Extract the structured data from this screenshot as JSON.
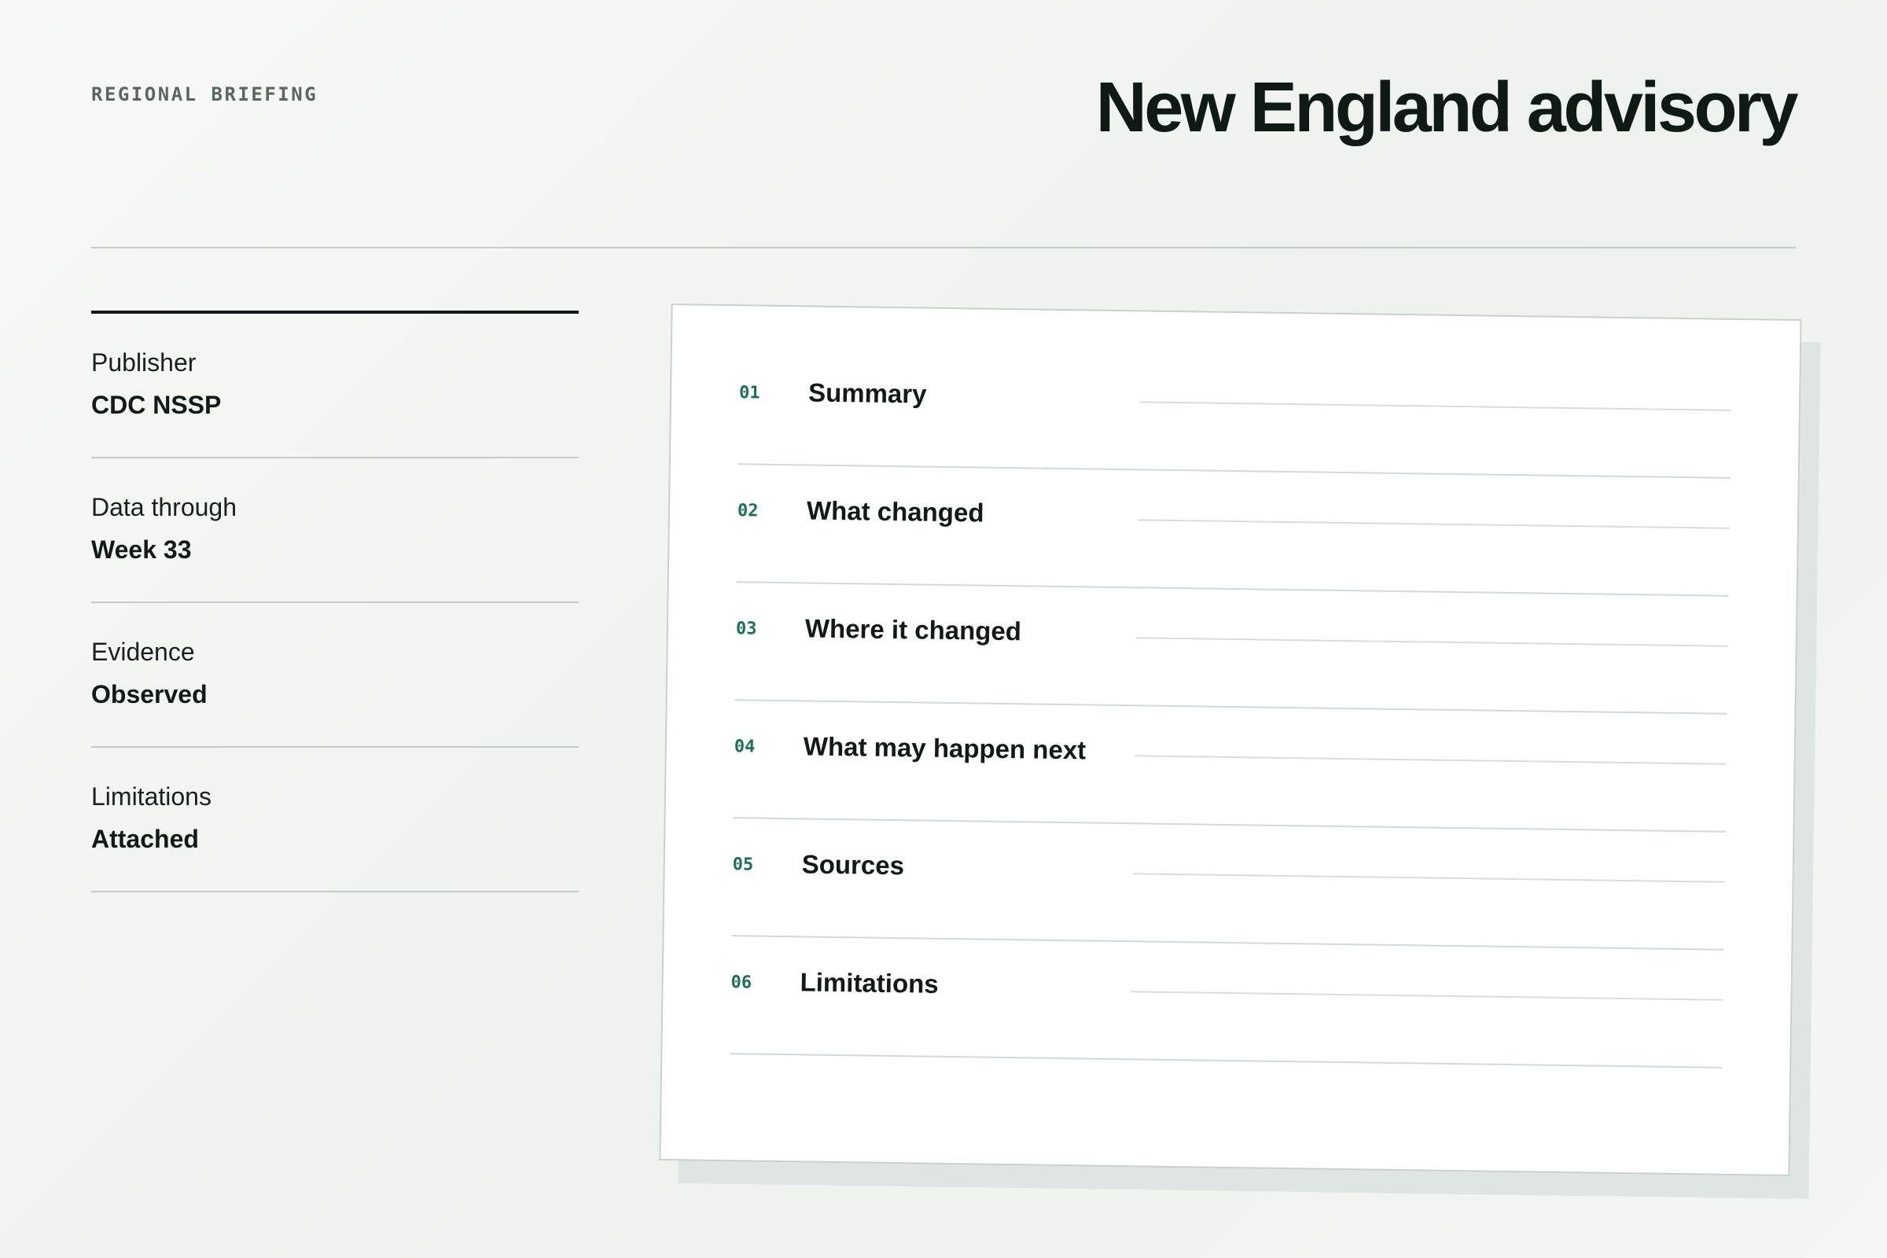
{
  "header": {
    "eyebrow": "REGIONAL BRIEFING",
    "title": "New England advisory"
  },
  "meta": [
    {
      "label": "Publisher",
      "value": "CDC NSSP"
    },
    {
      "label": "Data through",
      "value": "Week 33"
    },
    {
      "label": "Evidence",
      "value": "Observed"
    },
    {
      "label": "Limitations",
      "value": "Attached"
    }
  ],
  "toc": [
    {
      "num": "01",
      "label": "Summary"
    },
    {
      "num": "02",
      "label": "What changed"
    },
    {
      "num": "03",
      "label": "Where it changed"
    },
    {
      "num": "04",
      "label": "What may happen next"
    },
    {
      "num": "05",
      "label": "Sources"
    },
    {
      "num": "06",
      "label": "Limitations"
    }
  ],
  "colors": {
    "accent": "#1f6f57",
    "ink": "#111a16",
    "rule": "#c4ccc8",
    "background": "#f3f6f3"
  }
}
